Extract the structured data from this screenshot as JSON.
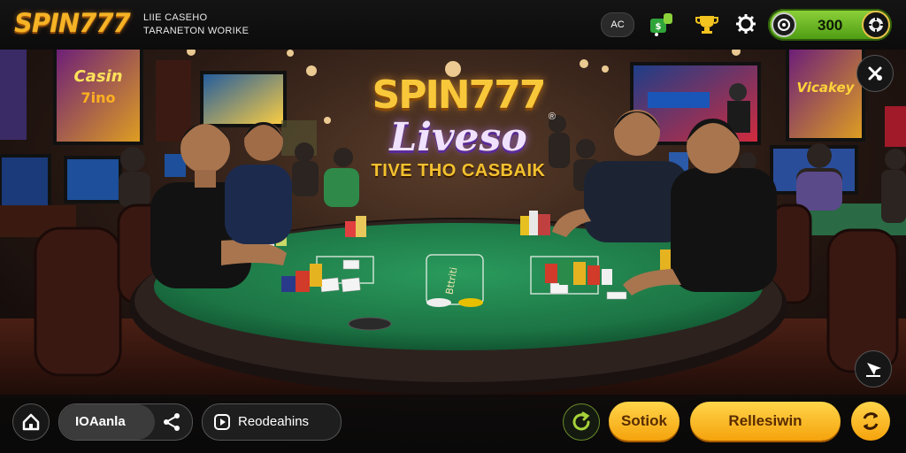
{
  "header": {
    "logo_text": "SPIN777",
    "subtitle_line1": "LIIE CASEHO",
    "subtitle_line2": "TARANETON WORIKE",
    "lang_badge": "AC",
    "balance_value": "300"
  },
  "headline": {
    "brand": "SPIN777",
    "live": "Liveso",
    "registered_mark": "®",
    "tagline": "TIVE THO CASBAIK"
  },
  "bottom": {
    "username": "IOAanla",
    "share_label": "Reodeahins",
    "small_action": "Sotiok",
    "big_action": "Rellesiwin"
  },
  "icons": {
    "home": "home-icon",
    "share": "share-icon",
    "play": "play-icon",
    "refresh": "refresh-icon",
    "swap": "swap-icon",
    "settings": "gear-icon",
    "trophy": "trophy-icon",
    "close": "close-icon",
    "pointer": "pointer-icon"
  },
  "colors": {
    "brand_gold": "#f5b325",
    "balance_green": "#6bbf22",
    "table_felt": "#1f7a4a",
    "action_yellow": "#ffc61f"
  }
}
